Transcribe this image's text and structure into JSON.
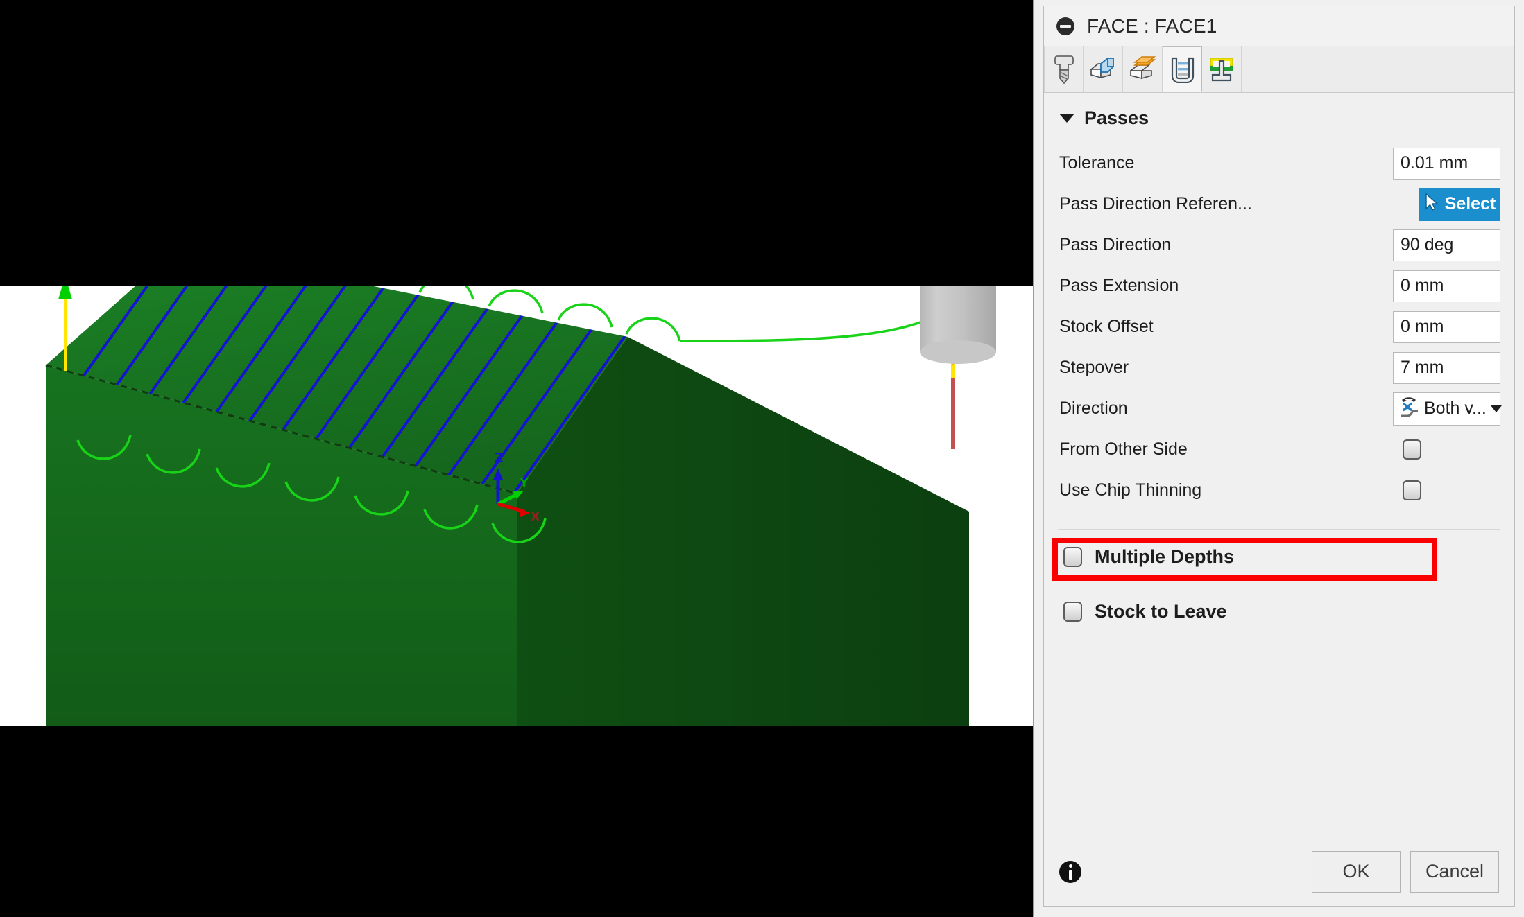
{
  "dialog": {
    "title": "FACE : FACE1",
    "collapse_icon": "minus-circle-icon",
    "tabs": [
      {
        "name": "tool-tab",
        "icon": "end-mill-tool-icon",
        "active": false
      },
      {
        "name": "geometry-tab",
        "icon": "blue-geometry-box-icon",
        "active": false
      },
      {
        "name": "heights-tab",
        "icon": "orange-heights-box-icon",
        "active": false
      },
      {
        "name": "passes-tab",
        "icon": "passes-u-channel-icon",
        "active": true
      },
      {
        "name": "linking-tab",
        "icon": "linking-t-shape-icon",
        "active": false
      }
    ],
    "section": {
      "title": "Passes",
      "expanded": true
    },
    "fields": [
      {
        "label": "Tolerance",
        "value": "0.01 mm",
        "type": "text"
      },
      {
        "label": "Pass Direction Referen...",
        "value": "Select",
        "type": "select-button"
      },
      {
        "label": "Pass Direction",
        "value": "90 deg",
        "type": "text"
      },
      {
        "label": "Pass Extension",
        "value": "0 mm",
        "type": "text"
      },
      {
        "label": "Stock Offset",
        "value": "0 mm",
        "type": "text"
      },
      {
        "label": "Stepover",
        "value": "7 mm",
        "type": "text"
      },
      {
        "label": "Direction",
        "value": "Both v...",
        "type": "dropdown"
      },
      {
        "label": "From Other Side",
        "value": "",
        "type": "checkbox",
        "checked": false,
        "highlighted": true
      },
      {
        "label": "Use Chip Thinning",
        "value": "",
        "type": "checkbox",
        "checked": false,
        "highlighted": false
      }
    ],
    "groups": [
      {
        "label": "Multiple Depths",
        "checked": false
      },
      {
        "label": "Stock to Leave",
        "checked": false
      }
    ],
    "footer": {
      "info_icon": "info-icon",
      "ok_label": "OK",
      "cancel_label": "Cancel"
    },
    "colors": {
      "accent_blue": "#1b8fce",
      "highlight_red": "#fb0000",
      "panel_bg": "#f0f0f0",
      "field_bg": "#ffffff"
    }
  },
  "viewport": {
    "name": "cam-3d-viewport",
    "background": "#ffffff",
    "letterbox_color": "#000000",
    "stock_color_top": "#1b7a24",
    "stock_color_front": "#18681e",
    "stock_color_side": "#0e4a12",
    "toolpath_cut_color": "#1414d2",
    "toolpath_leadin_color": "#00c000",
    "rapid_color": "#ffe500",
    "plunge_color": "#c45050",
    "tool_color": "#c0c0c0",
    "axis_labels": [
      "Z",
      "Y",
      "X"
    ],
    "axis_colors": {
      "z": "#1414d2",
      "y": "#00d000",
      "x": "#e00000"
    },
    "pass_count": 13
  }
}
